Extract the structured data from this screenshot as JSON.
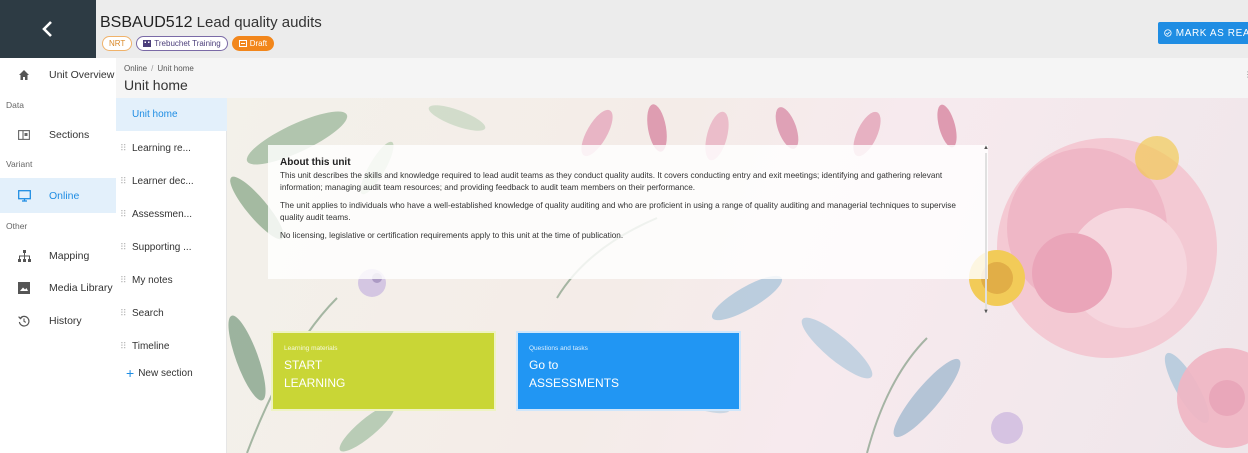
{
  "header": {
    "unit_code": "BSBAUD512",
    "unit_name": "Lead quality audits",
    "chips": {
      "nrt": "NRT",
      "org": "Trebuchet Training",
      "draft": "Draft"
    },
    "mark_read": "MARK AS READ"
  },
  "leftnav": {
    "unit_overview": "Unit Overview",
    "group_data": "Data",
    "sections": "Sections",
    "group_variant": "Variant",
    "online": "Online",
    "group_other": "Other",
    "mapping": "Mapping",
    "media_library": "Media Library",
    "history": "History"
  },
  "pagehead": {
    "crumb_1": "Online",
    "crumb_sep": "/",
    "crumb_2": "Unit home",
    "title": "Unit home"
  },
  "sections": {
    "items": [
      "Unit home",
      "Learning re...",
      "Learner dec...",
      "Assessmen...",
      "Supporting ...",
      "My notes",
      "Search",
      "Timeline"
    ],
    "new_section": "New section"
  },
  "about": {
    "heading": "About this unit",
    "p1": "This unit describes the skills and knowledge required to lead audit teams as they conduct quality audits. It covers conducting entry and exit meetings; identifying and gathering relevant information; managing audit team resources; and providing feedback to audit team members on their performance.",
    "p2": "The unit applies to individuals who have a well-established knowledge of quality auditing and who are proficient in using a range of quality auditing and managerial techniques to supervise quality audit teams.",
    "p3": "No licensing, legislative or certification requirements apply to this unit at the time of publication."
  },
  "tiles": {
    "learn_small": "Learning materials",
    "learn_line1": "START",
    "learn_line2": "LEARNING",
    "assess_small": "Questions and tasks",
    "assess_line1": "Go to",
    "assess_line2": "ASSESSMENTS"
  },
  "colors": {
    "accent": "#1f8de3",
    "sidebar_dark": "#2d3b44",
    "learn_tile": "#c9d636",
    "assess_tile": "#2196f3",
    "draft_chip": "#f2861b"
  }
}
